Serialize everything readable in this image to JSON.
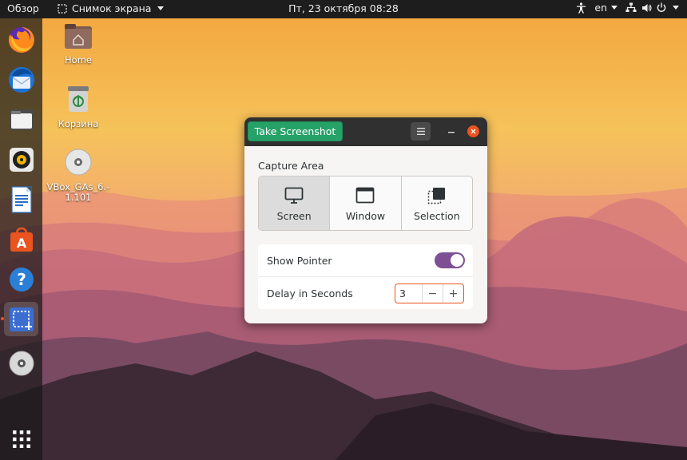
{
  "topbar": {
    "activities": "Обзор",
    "app_menu": "Снимок экрана",
    "clock": "Пт, 23 октября  08:28",
    "keyboard_layout": "en"
  },
  "desktop_icons": [
    {
      "label": "Home",
      "icon": "home-folder-icon"
    },
    {
      "label": "Корзина",
      "icon": "trash-icon"
    },
    {
      "label": "VBox_GAs_6.-\n1.101",
      "icon": "cd-disc-icon"
    }
  ],
  "dock": {
    "items": [
      {
        "name": "firefox",
        "icon": "firefox-icon"
      },
      {
        "name": "thunderbird",
        "icon": "thunderbird-icon"
      },
      {
        "name": "files",
        "icon": "files-icon"
      },
      {
        "name": "rhythmbox",
        "icon": "rhythmbox-icon"
      },
      {
        "name": "writer",
        "icon": "libreoffice-writer-icon"
      },
      {
        "name": "software",
        "icon": "software-center-icon"
      },
      {
        "name": "help",
        "icon": "help-icon"
      },
      {
        "name": "screenshot",
        "icon": "screenshot-icon",
        "active": true
      },
      {
        "name": "disc",
        "icon": "disc-icon"
      },
      {
        "name": "show-apps",
        "icon": "app-grid-icon"
      }
    ]
  },
  "window": {
    "take_screenshot": "Take Screenshot",
    "capture_area_label": "Capture Area",
    "capture_options": [
      {
        "label": "Screen",
        "selected": true
      },
      {
        "label": "Window",
        "selected": false
      },
      {
        "label": "Selection",
        "selected": false
      }
    ],
    "show_pointer_label": "Show Pointer",
    "show_pointer_on": true,
    "delay_label": "Delay in Seconds",
    "delay_value": "3",
    "minus": "−",
    "plus": "+"
  },
  "colors": {
    "accent": "#e95420",
    "take_button": "#26a269",
    "switch_on": "#7d4f94",
    "header": "#303030"
  }
}
